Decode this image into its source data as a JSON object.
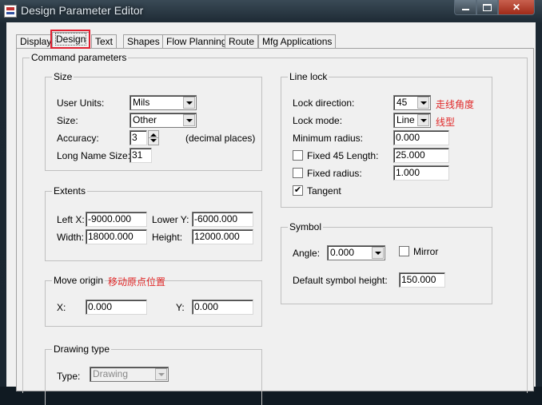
{
  "window": {
    "title": "Design Parameter Editor"
  },
  "tabs": [
    "Display",
    "Design",
    "Text",
    "Shapes",
    "Flow Planning",
    "Route",
    "Mfg Applications"
  ],
  "command_parameters": {
    "label": "Command parameters",
    "size": {
      "label": "Size",
      "user_units_label": "User Units:",
      "user_units_value": "Mils",
      "size_label": "Size:",
      "size_value": "Other",
      "accuracy_label": "Accuracy:",
      "accuracy_value": "3",
      "accuracy_suffix": "(decimal places)",
      "long_name_label": "Long Name Size:",
      "long_name_value": "31"
    },
    "extents": {
      "label": "Extents",
      "left_x_label": "Left X:",
      "left_x_value": "-9000.000",
      "lower_y_label": "Lower Y:",
      "lower_y_value": "-6000.000",
      "width_label": "Width:",
      "width_value": "18000.000",
      "height_label": "Height:",
      "height_value": "12000.000"
    },
    "move_origin": {
      "label": "Move origin",
      "note": "移动原点位置",
      "x_label": "X:",
      "x_value": "0.000",
      "y_label": "Y:",
      "y_value": "0.000"
    },
    "drawing_type": {
      "label": "Drawing type",
      "type_label": "Type:",
      "type_value": "Drawing"
    },
    "line_lock": {
      "label": "Line lock",
      "lock_direction_label": "Lock direction:",
      "lock_direction_value": "45",
      "lock_direction_note": "走线角度",
      "lock_mode_label": "Lock mode:",
      "lock_mode_value": "Line",
      "lock_mode_note": "线型",
      "min_radius_label": "Minimum radius:",
      "min_radius_value": "0.000",
      "fixed45_label": "Fixed 45 Length:",
      "fixed45_value": "25.000",
      "fixed45_checked": false,
      "fixed_radius_label": "Fixed radius:",
      "fixed_radius_value": "1.000",
      "fixed_radius_checked": false,
      "tangent_label": "Tangent",
      "tangent_checked": true
    },
    "symbol": {
      "label": "Symbol",
      "angle_label": "Angle:",
      "angle_value": "0.000",
      "mirror_label": "Mirror",
      "mirror_checked": false,
      "default_height_label": "Default symbol height:",
      "default_height_value": "150.000"
    }
  },
  "colors": {
    "annotation": "#e02828",
    "highlight_border": "#e02030"
  },
  "icons": {
    "check": "✔"
  }
}
